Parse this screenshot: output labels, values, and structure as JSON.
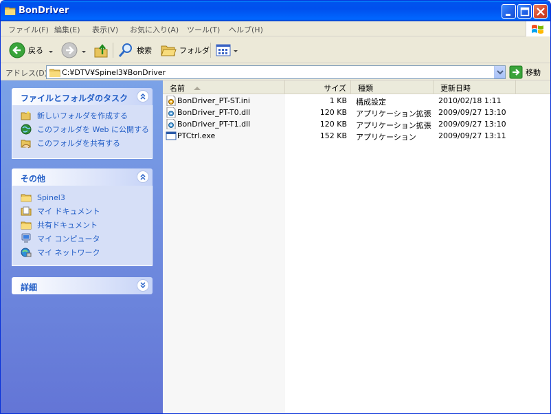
{
  "window": {
    "title": "BonDriver"
  },
  "menu": [
    "ファイル(F)",
    "編集(E)",
    "表示(V)",
    "お気に入り(A)",
    "ツール(T)",
    "ヘルプ(H)"
  ],
  "toolbar": {
    "back": "戻る",
    "search": "検索",
    "folders": "フォルダ"
  },
  "address": {
    "label": "アドレス(D)",
    "path": "C:¥DTV¥Spinel3¥BonDriver",
    "go": "移動"
  },
  "tasks_panel": {
    "title": "ファイルとフォルダのタスク",
    "items": [
      "新しいフォルダを作成する",
      "このフォルダを Web に公開する",
      "このフォルダを共有する"
    ]
  },
  "other_panel": {
    "title": "その他",
    "items": [
      "Spinel3",
      "マイ ドキュメント",
      "共有ドキュメント",
      "マイ コンピュータ",
      "マイ ネットワーク"
    ]
  },
  "details_panel": {
    "title": "詳細"
  },
  "columns": {
    "name": "名前",
    "size": "サイズ",
    "type": "種類",
    "modified": "更新日時"
  },
  "files": [
    {
      "name": "BonDriver_PT-ST.ini",
      "size": "1 KB",
      "type": "構成設定",
      "modified": "2010/02/18 1:11",
      "icon": "ini-file-icon"
    },
    {
      "name": "BonDriver_PT-T0.dll",
      "size": "120 KB",
      "type": "アプリケーション拡張",
      "modified": "2009/09/27 13:10",
      "icon": "dll-file-icon"
    },
    {
      "name": "BonDriver_PT-T1.dll",
      "size": "120 KB",
      "type": "アプリケーション拡張",
      "modified": "2009/09/27 13:10",
      "icon": "dll-file-icon"
    },
    {
      "name": "PTCtrl.exe",
      "size": "152 KB",
      "type": "アプリケーション",
      "modified": "2009/09/27 13:11",
      "icon": "exe-file-icon"
    }
  ],
  "colors": {
    "taskpane_top": "#7ba2e7",
    "taskpane_bottom": "#6375d6",
    "link": "#215dc6",
    "titlebar": "#0050ee"
  }
}
